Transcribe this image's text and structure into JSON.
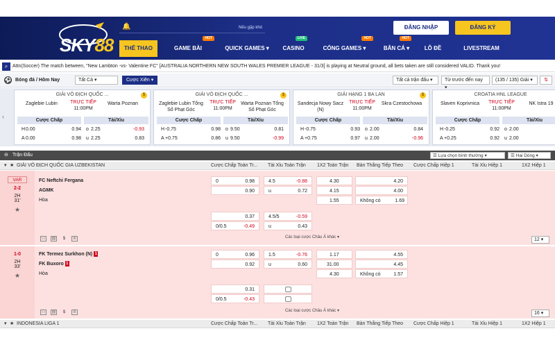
{
  "header": {
    "logo": "SKY88",
    "marquee": "Nếu gặp khó",
    "login": "ĐĂNG NHẬP",
    "register": "ĐĂNG KÝ",
    "nav": [
      {
        "label": "THỂ THAO",
        "badge": ""
      },
      {
        "label": "GAME BÀI",
        "badge": "HOT"
      },
      {
        "label": "QUICK GAMES ▾",
        "badge": ""
      },
      {
        "label": "CASINO",
        "badge": "LIVE"
      },
      {
        "label": "CỔNG GAMES ▾",
        "badge": "HOT"
      },
      {
        "label": "BẮN CÁ ▾",
        "badge": "HOT"
      },
      {
        "label": "LÔ ĐỀ",
        "badge": ""
      },
      {
        "label": "LIVESTREAM",
        "badge": ""
      }
    ]
  },
  "ticker": "Attn(Soccer) The match between, \"New Lambton -vs- Valentine FC\" [AUSTRALIA NORTHERN NEW SOUTH WALES PREMIER LEAGUE - 31/3] is playing at Neutral ground, all bets taken are still considered VALID. Thank you!",
  "filter": {
    "title": "Bóng đá / Hôm Nay",
    "sel_all": "Tất Cả",
    "xien": "Cược Xiên",
    "sel_bet": "Tất cả trận đấu",
    "sel_time": "Từ trước đến nay",
    "sel_count": "(135 / 135) Giải"
  },
  "cards": [
    {
      "league": "GIẢI VÔ ĐỊCH QUỐC ...",
      "home": "Zaglebie Lubin",
      "away": "Warta Poznan",
      "live": "TRỰC TIẾP",
      "time": "11:00PM",
      "h1": "Cược Chấp",
      "h2": "Tài/Xỉu",
      "r1": [
        "H",
        "0.00",
        "0.94",
        "o",
        "2.25",
        "-0.93"
      ],
      "r2": [
        "A",
        "0.00",
        "0.98",
        "u",
        "2.25",
        "0.83"
      ]
    },
    {
      "league": "GIẢI VÔ ĐỊCH QUỐC ...",
      "home": "Zaglebie Lubin Tổng Số Phạt Góc",
      "away": "Warta Poznan Tổng Số Phạt Góc",
      "live": "TRỰC TIẾP",
      "time": "11:00PM",
      "h1": "Cược Chấp",
      "h2": "Tài/Xỉu",
      "r1": [
        "H",
        "-0.75",
        "0.98",
        "o",
        "9.50",
        "0.81"
      ],
      "r2": [
        "A",
        "+0.75",
        "0.86",
        "u",
        "9.50",
        "-0.99"
      ]
    },
    {
      "league": "GIẢI HẠNG 1 BA LAN",
      "home": "Sandecja Nowy Sacz (N)",
      "away": "Skra Czestochowa",
      "live": "TRỰC TIẾP",
      "time": "11:00PM",
      "h1": "Cược Chấp",
      "h2": "Tài/Xỉu",
      "r1": [
        "H",
        "-0.75",
        "0.93",
        "o",
        "2.00",
        "0.84"
      ],
      "r2": [
        "A",
        "+0.75",
        "0.97",
        "u",
        "2.00",
        "-0.96"
      ]
    },
    {
      "league": "CROATIA HNL LEAGUE",
      "home": "Slaven Koprivnica",
      "away": "NK Istra 19",
      "live": "TRỰC TIẾP",
      "time": "11:00PM",
      "h1": "Cược Chấp",
      "h2": "Tài/Xỉu",
      "r1": [
        "H",
        "-0.25",
        "0.92",
        "o",
        "2.00",
        ""
      ],
      "r2": [
        "A",
        "+0.25",
        "0.92",
        "u",
        "2.00",
        ""
      ]
    }
  ],
  "section": {
    "title": "Trận Đấu",
    "sel1": "Lựa chọn bình thường",
    "sel2": "Hai Dòng"
  },
  "cols": [
    "Cược Chấp Toàn Tr...",
    "Tài Xỉu Toàn Trận",
    "1X2 Toàn Trận",
    "Bàn Thắng Tiếp Theo",
    "Cược Chấp Hiệp 1",
    "Tài Xỉu Hiệp 1",
    "1X2 Hiệp 1"
  ],
  "league1": "GIẢI VÔ ĐỊCH QUỐC GIA UZBEKISTAN",
  "m1": {
    "var": "VAR",
    "score": "2-2",
    "half": "2H",
    "min": "31'",
    "home": "FC Neftchi Fergana",
    "away": "AGMK",
    "draw": "Hòa",
    "hdp": [
      [
        "0",
        "0.98"
      ],
      [
        "",
        "0.90"
      ]
    ],
    "ou": [
      [
        "4.5",
        "-0.88"
      ],
      [
        "u",
        "0.72"
      ]
    ],
    "x12": [
      "4.30",
      "4.15",
      "1.55"
    ],
    "next": [
      "4.20",
      "4.00",
      "1.69"
    ],
    "none": "Không có",
    "hdp2": [
      [
        "",
        "0.37"
      ],
      [
        "0/0.5",
        "-0.49"
      ]
    ],
    "ou2": [
      [
        "4.5/5",
        "-0.59"
      ],
      [
        "u",
        "0.43"
      ]
    ],
    "more": "Các loại cược Châu Á khác",
    "count": "12"
  },
  "m2": {
    "score": "1-0",
    "half": "2H",
    "min": "33'",
    "home": "FK Termez Surkhon (N)",
    "homecard": "1",
    "away": "FK Buxoro",
    "awaycard": "1",
    "draw": "Hòa",
    "hdp": [
      [
        "0",
        "0.96"
      ],
      [
        "",
        "0.92"
      ]
    ],
    "ou": [
      [
        "1.5",
        "-0.76"
      ],
      [
        "u",
        "0.60"
      ]
    ],
    "x12": [
      "1.17",
      "31.00",
      "4.30"
    ],
    "next": [
      "4.55",
      "4.45",
      "1.57"
    ],
    "none": "Không có",
    "hdp2": [
      [
        "",
        "0.31"
      ],
      [
        "0/0.5",
        "-0.43"
      ]
    ],
    "more": "Các loại cược Châu Á khác",
    "count": "16"
  },
  "league2": "INDONESIA LIGA 1"
}
